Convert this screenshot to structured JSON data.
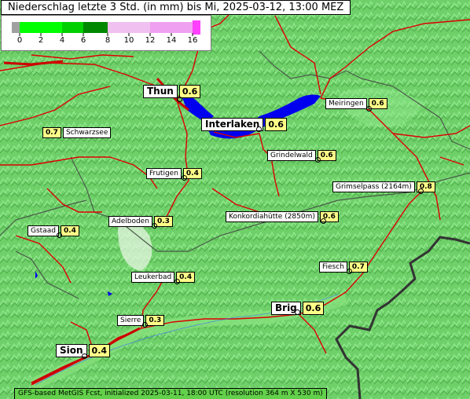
{
  "header": {
    "title": "Niederschlag letzte 3 Std. (in mm) bis Mi, 2025-03-12, 13:00 MEZ"
  },
  "legend": {
    "ticks": [
      "0",
      "2",
      "4",
      "6",
      "8",
      "10",
      "12",
      "14",
      "16"
    ],
    "colors": [
      "#a0a0a0",
      "#00ff00",
      "#00d000",
      "#008800",
      "#f0c0f0",
      "#f0a0f0",
      "#ff40ff"
    ]
  },
  "footer": {
    "text": "GFS-based MetGIS Fcst, initialized 2025-03-11, 18:00 UTC  (resolution 364 m X 530 m)"
  },
  "stations": [
    {
      "name": "Thun",
      "value": "0.6"
    },
    {
      "name": "Interlaken",
      "value": "0.6"
    },
    {
      "name": "Meiringen",
      "value": "0.6"
    },
    {
      "name": "Schwarzsee",
      "value": "0.7"
    },
    {
      "name": "Grindelwald",
      "value": "0.6"
    },
    {
      "name": "Frutigen",
      "value": "0.4"
    },
    {
      "name": "Grimselpass (2164m)",
      "value": "0.8"
    },
    {
      "name": "Konkordiahütte (2850m)",
      "value": "0.6"
    },
    {
      "name": "Adelboden",
      "value": "0.3"
    },
    {
      "name": "Gstaad",
      "value": "0.4"
    },
    {
      "name": "Fiesch",
      "value": "0.7"
    },
    {
      "name": "Leukerbad",
      "value": "0.4"
    },
    {
      "name": "Brig",
      "value": "0.6"
    },
    {
      "name": "Sierre",
      "value": "0.3"
    },
    {
      "name": "Sion",
      "value": "0.4"
    }
  ],
  "colors": {
    "terrain": "#6fd06a",
    "lake": "#0000ee",
    "roads": "#dd0000",
    "border": "#333333"
  }
}
